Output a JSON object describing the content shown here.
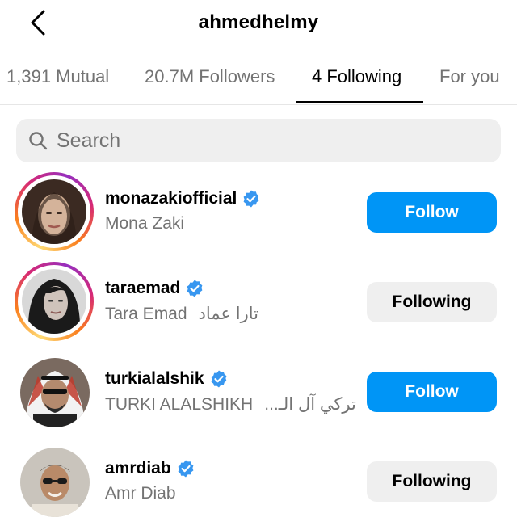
{
  "header": {
    "title": "ahmedhelmy"
  },
  "tabs": [
    {
      "label": "1,391 Mutual"
    },
    {
      "label": "20.7M Followers"
    },
    {
      "label": "4 Following"
    },
    {
      "label": "For you"
    }
  ],
  "active_tab": "4 Following",
  "search": {
    "placeholder": "Search",
    "value": ""
  },
  "users": [
    {
      "username": "monazakiofficial",
      "full_name": "Mona Zaki",
      "full_name_ar": "",
      "verified": true,
      "has_story": true,
      "button": "Follow"
    },
    {
      "username": "taraemad",
      "full_name": "Tara Emad",
      "full_name_ar": "تارا عماد",
      "verified": true,
      "has_story": true,
      "button": "Following"
    },
    {
      "username": "turkialalshik",
      "full_name": "TURKI ALALSHIKH",
      "full_name_ar": "تركي آل الـ...",
      "verified": true,
      "has_story": false,
      "button": "Follow"
    },
    {
      "username": "amrdiab",
      "full_name": "Amr Diab",
      "full_name_ar": "",
      "verified": true,
      "has_story": false,
      "button": "Following"
    }
  ],
  "colors": {
    "accent": "#0095f6",
    "verified": "#3897f0",
    "secondary_text": "#737373",
    "button_gray": "#efefef"
  }
}
